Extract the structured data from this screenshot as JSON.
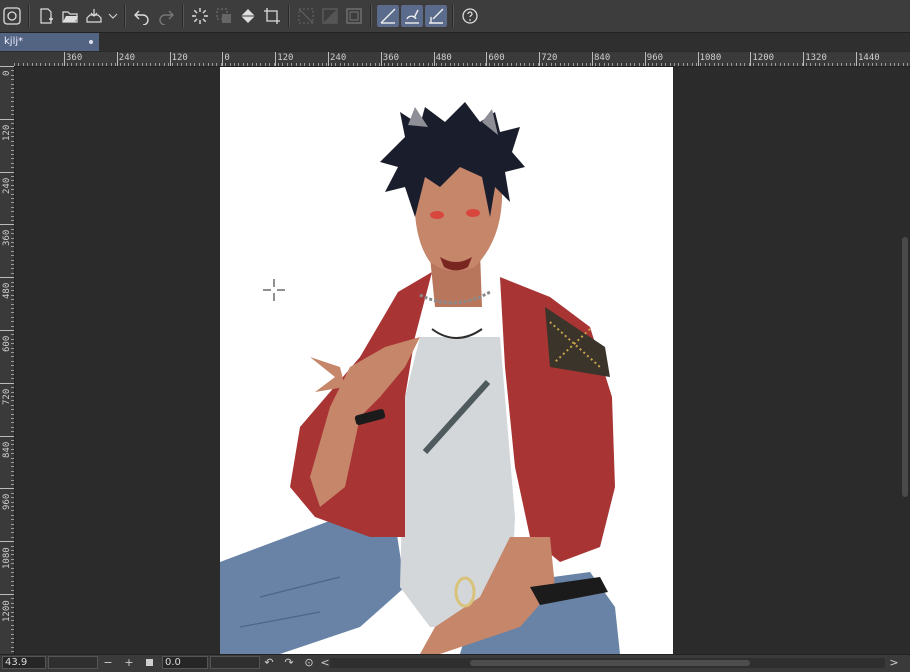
{
  "toolbar": {
    "icons": [
      "clip-studio-icon",
      "new-file-icon",
      "open-folder-icon",
      "save-icon",
      "dropdown-chevron-icon",
      "undo-icon",
      "redo-icon",
      "loading-icon",
      "selection-icon",
      "fill-icon",
      "crop-icon",
      "clear-selection-icon",
      "invert-selection-icon",
      "border-icon",
      "snap-ruler-icon",
      "snap-special-ruler-icon",
      "snap-grid-icon",
      "help-icon"
    ]
  },
  "tab": {
    "title": "kjlj*"
  },
  "ruler": {
    "h_labels": [
      "360",
      "240",
      "120",
      "0",
      "120",
      "240",
      "360",
      "480",
      "600",
      "720",
      "840",
      "960",
      "1080",
      "1200",
      "1320",
      "1440"
    ],
    "v_labels": [
      "0",
      "120",
      "240",
      "360",
      "480",
      "600",
      "720",
      "840",
      "960",
      "1080",
      "1200"
    ]
  },
  "status": {
    "zoom": "43.9",
    "rotation": "0.0",
    "minus": "−",
    "plus": "+",
    "left_arrow": "<",
    "right_arrow": ">"
  },
  "colors": {
    "canvas_bg": "#2b2b2b",
    "paper": "#ffffff",
    "tab_active": "#536482",
    "jacket": "#a83434",
    "jeans": "#6883a6",
    "skin": "#c5866a",
    "hair": "#1a1d2c"
  }
}
